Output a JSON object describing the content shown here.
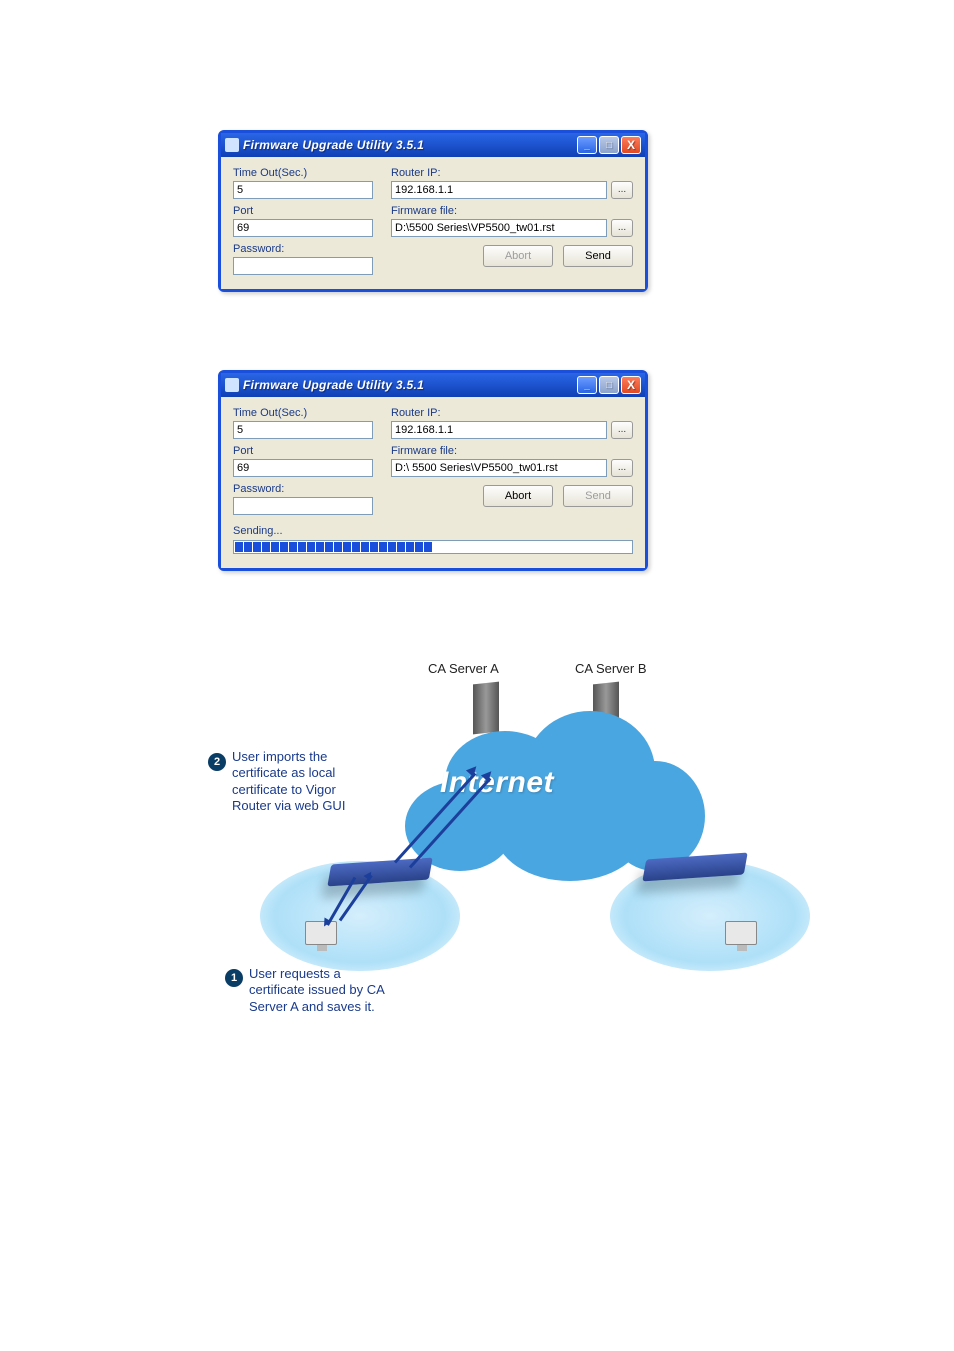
{
  "window1": {
    "title": "Firmware Upgrade Utility 3.5.1",
    "labels": {
      "timeout": "Time Out(Sec.)",
      "port": "Port",
      "password": "Password:",
      "routerip": "Router IP:",
      "firmwarefile": "Firmware file:"
    },
    "values": {
      "timeout": "5",
      "port": "69",
      "password": "",
      "routerip": "192.168.1.1",
      "firmwarefile": "D:\\5500 Series\\VP5500_tw01.rst"
    },
    "buttons": {
      "browse": "...",
      "abort": "Abort",
      "send": "Send"
    },
    "abort_enabled": false,
    "send_enabled": true
  },
  "window2": {
    "title": "Firmware Upgrade Utility 3.5.1",
    "labels": {
      "timeout": "Time Out(Sec.)",
      "port": "Port",
      "password": "Password:",
      "routerip": "Router IP:",
      "firmwarefile": "Firmware file:"
    },
    "values": {
      "timeout": "5",
      "port": "69",
      "password": "",
      "routerip": "192.168.1.1",
      "firmwarefile": "D:\\ 5500 Series\\VP5500_tw01.rst"
    },
    "buttons": {
      "browse": "...",
      "abort": "Abort",
      "send": "Send"
    },
    "abort_enabled": true,
    "send_enabled": false,
    "status": "Sending...",
    "progress_blocks": 22
  },
  "diagram": {
    "server_a": "CA Server A",
    "server_b": "CA Server B",
    "cloud": "Internet",
    "step2_num": "2",
    "step2_text": "User imports the\ncertificate as local\ncertificate to Vigor\nRouter via web GUI",
    "step1_num": "1",
    "step1_text": "User requests a\ncertificate issued by CA\nServer A and saves it."
  }
}
